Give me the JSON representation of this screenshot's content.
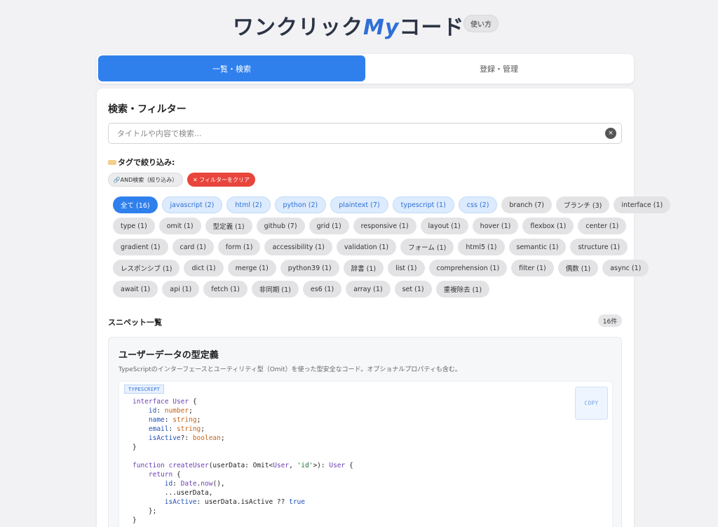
{
  "header": {
    "title_part1": "ワンクリック",
    "title_my": "My",
    "title_part2": "コード",
    "help_label": "使い方"
  },
  "tabs": {
    "list_search": "一覧・検索",
    "register_manage": "登録・管理"
  },
  "search_section": {
    "title": "検索・フィルター",
    "placeholder": "タイトルや内容で検索...",
    "clear_icon": "×"
  },
  "tag_filter": {
    "label": "タグで絞り込み:",
    "and_search_label": "🔗AND検索（絞り込み）",
    "clear_filter_label": "✕ フィルターをクリア",
    "rows": [
      [
        {
          "label": "全て (16)",
          "style": "active"
        },
        {
          "label": "javascript (2)",
          "style": "blue"
        },
        {
          "label": "html (2)",
          "style": "blue"
        },
        {
          "label": "python (2)",
          "style": "blue"
        },
        {
          "label": "plaintext (7)",
          "style": "blue"
        },
        {
          "label": "typescript (1)",
          "style": "blue"
        },
        {
          "label": "css (2)",
          "style": "blue"
        },
        {
          "label": "branch (7)",
          "style": "gray"
        },
        {
          "label": "ブランチ (3)",
          "style": "gray"
        },
        {
          "label": "interface (1)",
          "style": "gray"
        }
      ],
      [
        {
          "label": "type (1)",
          "style": "gray"
        },
        {
          "label": "omit (1)",
          "style": "gray"
        },
        {
          "label": "型定義 (1)",
          "style": "gray"
        },
        {
          "label": "github (7)",
          "style": "gray"
        },
        {
          "label": "grid (1)",
          "style": "gray"
        },
        {
          "label": "responsive (1)",
          "style": "gray"
        },
        {
          "label": "layout (1)",
          "style": "gray"
        },
        {
          "label": "hover (1)",
          "style": "gray"
        },
        {
          "label": "flexbox (1)",
          "style": "gray"
        },
        {
          "label": "center (1)",
          "style": "gray"
        }
      ],
      [
        {
          "label": "gradient (1)",
          "style": "gray"
        },
        {
          "label": "card (1)",
          "style": "gray"
        },
        {
          "label": "form (1)",
          "style": "gray"
        },
        {
          "label": "accessibility (1)",
          "style": "gray"
        },
        {
          "label": "validation (1)",
          "style": "gray"
        },
        {
          "label": "フォーム (1)",
          "style": "gray"
        },
        {
          "label": "html5 (1)",
          "style": "gray"
        },
        {
          "label": "semantic (1)",
          "style": "gray"
        },
        {
          "label": "structure (1)",
          "style": "gray"
        }
      ],
      [
        {
          "label": "レスポンシブ (1)",
          "style": "gray"
        },
        {
          "label": "dict (1)",
          "style": "gray"
        },
        {
          "label": "merge (1)",
          "style": "gray"
        },
        {
          "label": "python39 (1)",
          "style": "gray"
        },
        {
          "label": "辞書 (1)",
          "style": "gray"
        },
        {
          "label": "list (1)",
          "style": "gray"
        },
        {
          "label": "comprehension (1)",
          "style": "gray"
        },
        {
          "label": "filter (1)",
          "style": "gray"
        },
        {
          "label": "偶数 (1)",
          "style": "gray"
        },
        {
          "label": "async (1)",
          "style": "gray"
        }
      ],
      [
        {
          "label": "await (1)",
          "style": "gray"
        },
        {
          "label": "api (1)",
          "style": "gray"
        },
        {
          "label": "fetch (1)",
          "style": "gray"
        },
        {
          "label": "非同期 (1)",
          "style": "gray"
        },
        {
          "label": "es6 (1)",
          "style": "gray"
        },
        {
          "label": "array (1)",
          "style": "gray"
        },
        {
          "label": "set (1)",
          "style": "gray"
        },
        {
          "label": "重複除去 (1)",
          "style": "gray"
        }
      ]
    ]
  },
  "snippets": {
    "list_title": "スニペット一覧",
    "count": "16件",
    "items": [
      {
        "title": "ユーザーデータの型定義",
        "description": "TypeScriptのインターフェースとユーティリティ型（Omit）を使った型安全なコード。オプショナルプロパティも含む。",
        "language": "TYPESCRIPT",
        "copy_label": "COPY",
        "code_lines": [
          "interface User {",
          "    id: number;",
          "    name: string;",
          "    email: string;",
          "    isActive?: boolean;",
          "}",
          "",
          "function createUser(userData: Omit<User, 'id'>): User {",
          "    return {",
          "        id: Date.now(),",
          "        ...userData,",
          "        isActive: userData.isActive ?? true",
          "    };",
          "}"
        ]
      }
    ]
  },
  "colors": {
    "accent": "#2f80ed",
    "danger": "#e8453c",
    "title_accent": "#2f6fd6",
    "title_dark": "#2b3445"
  }
}
